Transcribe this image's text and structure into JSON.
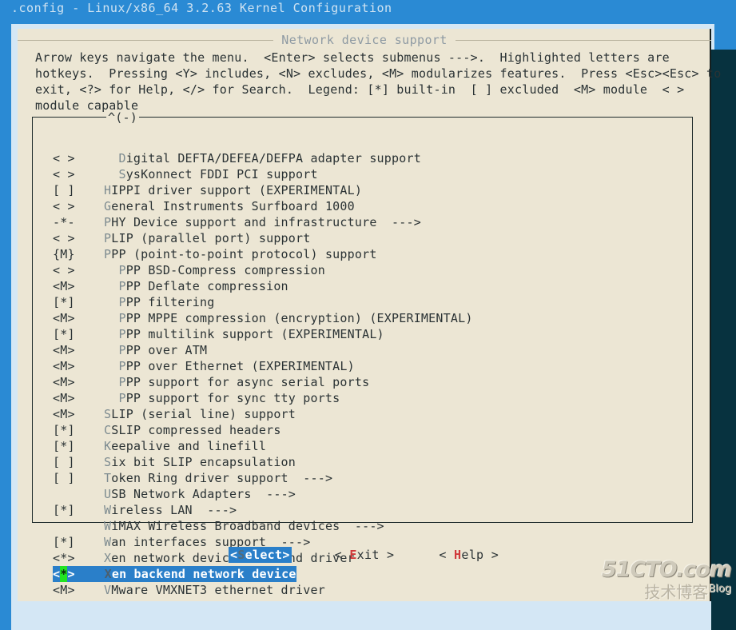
{
  "window": {
    "title": ".config - Linux/x86_64 3.2.63 Kernel Configuration"
  },
  "dialog": {
    "title": "Network device support",
    "help_text": "Arrow keys navigate the menu.  <Enter> selects submenus --->.  Highlighted letters are\nhotkeys.  Pressing <Y> includes, <N> excludes, <M> modularizes features.  Press <Esc><Esc> to\nexit, <?> for Help, </> for Search.  Legend: [*] built-in  [ ] excluded  <M> module  < >\nmodule capable",
    "scroll_marker": "^(-)"
  },
  "menu": {
    "items": [
      {
        "mark": "< >",
        "indent": "      ",
        "hotkey": "D",
        "label": "igital DEFTA/DEFEA/DEFPA adapter support",
        "arrow": ""
      },
      {
        "mark": "< >",
        "indent": "      ",
        "hotkey": "S",
        "label": "ysKonnect FDDI PCI support",
        "arrow": ""
      },
      {
        "mark": "[ ]",
        "indent": "    ",
        "hotkey": "H",
        "label": "IPPI driver support (EXPERIMENTAL)",
        "arrow": ""
      },
      {
        "mark": "< >",
        "indent": "    ",
        "hotkey": "G",
        "label": "eneral Instruments Surfboard 1000",
        "arrow": ""
      },
      {
        "mark": "-*-",
        "indent": "    ",
        "hotkey": "P",
        "label": "HY Device support and infrastructure",
        "arrow": "  --->"
      },
      {
        "mark": "< >",
        "indent": "    ",
        "hotkey": "P",
        "label": "LIP (parallel port) support",
        "arrow": ""
      },
      {
        "mark": "{M}",
        "indent": "    ",
        "hotkey": "P",
        "label": "PP (point-to-point protocol) support",
        "arrow": ""
      },
      {
        "mark": "< >",
        "indent": "      ",
        "hotkey": "P",
        "label": "PP BSD-Compress compression",
        "arrow": ""
      },
      {
        "mark": "<M>",
        "indent": "      ",
        "hotkey": "P",
        "label": "PP Deflate compression",
        "arrow": ""
      },
      {
        "mark": "[*]",
        "indent": "      ",
        "hotkey": "P",
        "label": "PP filtering",
        "arrow": ""
      },
      {
        "mark": "<M>",
        "indent": "      ",
        "hotkey": "P",
        "label": "PP MPPE compression (encryption) (EXPERIMENTAL)",
        "arrow": ""
      },
      {
        "mark": "[*]",
        "indent": "      ",
        "hotkey": "P",
        "label": "PP multilink support (EXPERIMENTAL)",
        "arrow": ""
      },
      {
        "mark": "<M>",
        "indent": "      ",
        "hotkey": "P",
        "label": "PP over ATM",
        "arrow": ""
      },
      {
        "mark": "<M>",
        "indent": "      ",
        "hotkey": "P",
        "label": "PP over Ethernet (EXPERIMENTAL)",
        "arrow": ""
      },
      {
        "mark": "<M>",
        "indent": "      ",
        "hotkey": "P",
        "label": "PP support for async serial ports",
        "arrow": ""
      },
      {
        "mark": "<M>",
        "indent": "      ",
        "hotkey": "P",
        "label": "PP support for sync tty ports",
        "arrow": ""
      },
      {
        "mark": "<M>",
        "indent": "    ",
        "hotkey": "S",
        "label": "LIP (serial line) support",
        "arrow": ""
      },
      {
        "mark": "[*]",
        "indent": "    ",
        "hotkey": "C",
        "label": "SLIP compressed headers",
        "arrow": ""
      },
      {
        "mark": "[*]",
        "indent": "    ",
        "hotkey": "K",
        "label": "eepalive and linefill",
        "arrow": ""
      },
      {
        "mark": "[ ]",
        "indent": "    ",
        "hotkey": "S",
        "label": "ix bit SLIP encapsulation",
        "arrow": ""
      },
      {
        "mark": "[ ]",
        "indent": "    ",
        "hotkey": "T",
        "label": "oken Ring driver support",
        "arrow": "  --->"
      },
      {
        "mark": "   ",
        "indent": "    ",
        "hotkey": "U",
        "label": "SB Network Adapters",
        "arrow": "  --->"
      },
      {
        "mark": "[*]",
        "indent": "    ",
        "hotkey": "W",
        "label": "ireless LAN",
        "arrow": "  --->"
      },
      {
        "mark": "   ",
        "indent": "    ",
        "hotkey": "W",
        "label": "iMAX Wireless Broadband devices",
        "arrow": "  --->"
      },
      {
        "mark": "[*]",
        "indent": "    ",
        "hotkey": "W",
        "label": "an interfaces support",
        "arrow": "  --->"
      },
      {
        "mark": "<*>",
        "indent": "    ",
        "hotkey": "X",
        "label": "en network device frontend driver",
        "arrow": ""
      },
      {
        "mark": "<*>",
        "indent": "    ",
        "hotkey": "X",
        "label": "en backend network device",
        "arrow": "",
        "selected": true,
        "cursor_char": "*",
        "mark_prefix": "<",
        "mark_suffix": ">"
      },
      {
        "mark": "<M>",
        "indent": "    ",
        "hotkey": "V",
        "label": "Mware VMXNET3 ethernet driver",
        "arrow": ""
      }
    ]
  },
  "buttons": [
    {
      "open": "<",
      "hotkey": "S",
      "rest": "elect",
      "close": ">",
      "active": true
    },
    {
      "open": "< ",
      "hotkey": "E",
      "rest": "xit",
      "close": " >",
      "active": false
    },
    {
      "open": "< ",
      "hotkey": "H",
      "rest": "elp",
      "close": " >",
      "active": false
    }
  ],
  "watermark": {
    "main": "51CTO.com",
    "sub": "技术博客",
    "blog": "Blog"
  },
  "colors": {
    "desktop_blue": "#2a8ad4",
    "dialog_cream": "#ece6d4",
    "highlight_blue": "#2a7fc9",
    "cursor_green": "#22e322",
    "hotkey_red": "#d0393b",
    "text_dark": "#2a3234",
    "shadow_navy": "#07323f"
  }
}
